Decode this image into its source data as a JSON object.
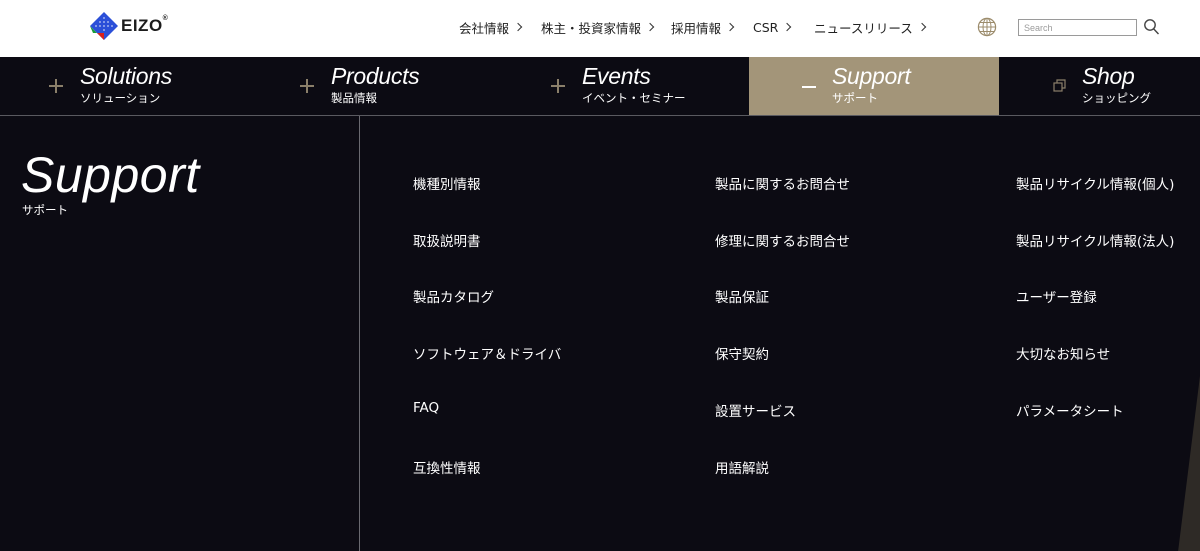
{
  "brand": {
    "logo_text": "EIZO",
    "reg_mark": "®"
  },
  "top_nav": {
    "items": [
      {
        "label": "会社情報"
      },
      {
        "label": "株主・投資家情報"
      },
      {
        "label": "採用情報"
      },
      {
        "label": "CSR"
      },
      {
        "label": "ニュースリリース"
      }
    ],
    "globe_icon": "globe-icon",
    "search": {
      "placeholder": "Search",
      "value": "",
      "icon": "search-icon"
    }
  },
  "main_nav": {
    "items": [
      {
        "title": "Solutions",
        "subtitle": "ソリューション",
        "icon": "plus-icon"
      },
      {
        "title": "Products",
        "subtitle": "製品情報",
        "icon": "plus-icon"
      },
      {
        "title": "Events",
        "subtitle": "イベント・セミナー",
        "icon": "plus-icon"
      },
      {
        "title": "Support",
        "subtitle": "サポート",
        "icon": "minus-icon",
        "active": true
      },
      {
        "title": "Shop",
        "subtitle": "ショッピング",
        "icon": "external-window-icon"
      }
    ],
    "active_color": "#a39579"
  },
  "support_panel": {
    "title": "Support",
    "subtitle": "サポート",
    "columns": [
      [
        "機種別情報",
        "取扱説明書",
        "製品カタログ",
        "ソフトウェア＆ドライバ",
        "FAQ",
        "互換性情報"
      ],
      [
        "製品に関するお問合せ",
        "修理に関するお問合せ",
        "製品保証",
        "保守契約",
        "設置サービス",
        "用語解説"
      ],
      [
        "製品リサイクル情報(個人)",
        "製品リサイクル情報(法人)",
        "ユーザー登録",
        "大切なお知らせ",
        "パラメータシート"
      ]
    ]
  },
  "colors": {
    "background": "#0c0b13",
    "accent": "#a39579",
    "header_bg": "#ffffff"
  }
}
